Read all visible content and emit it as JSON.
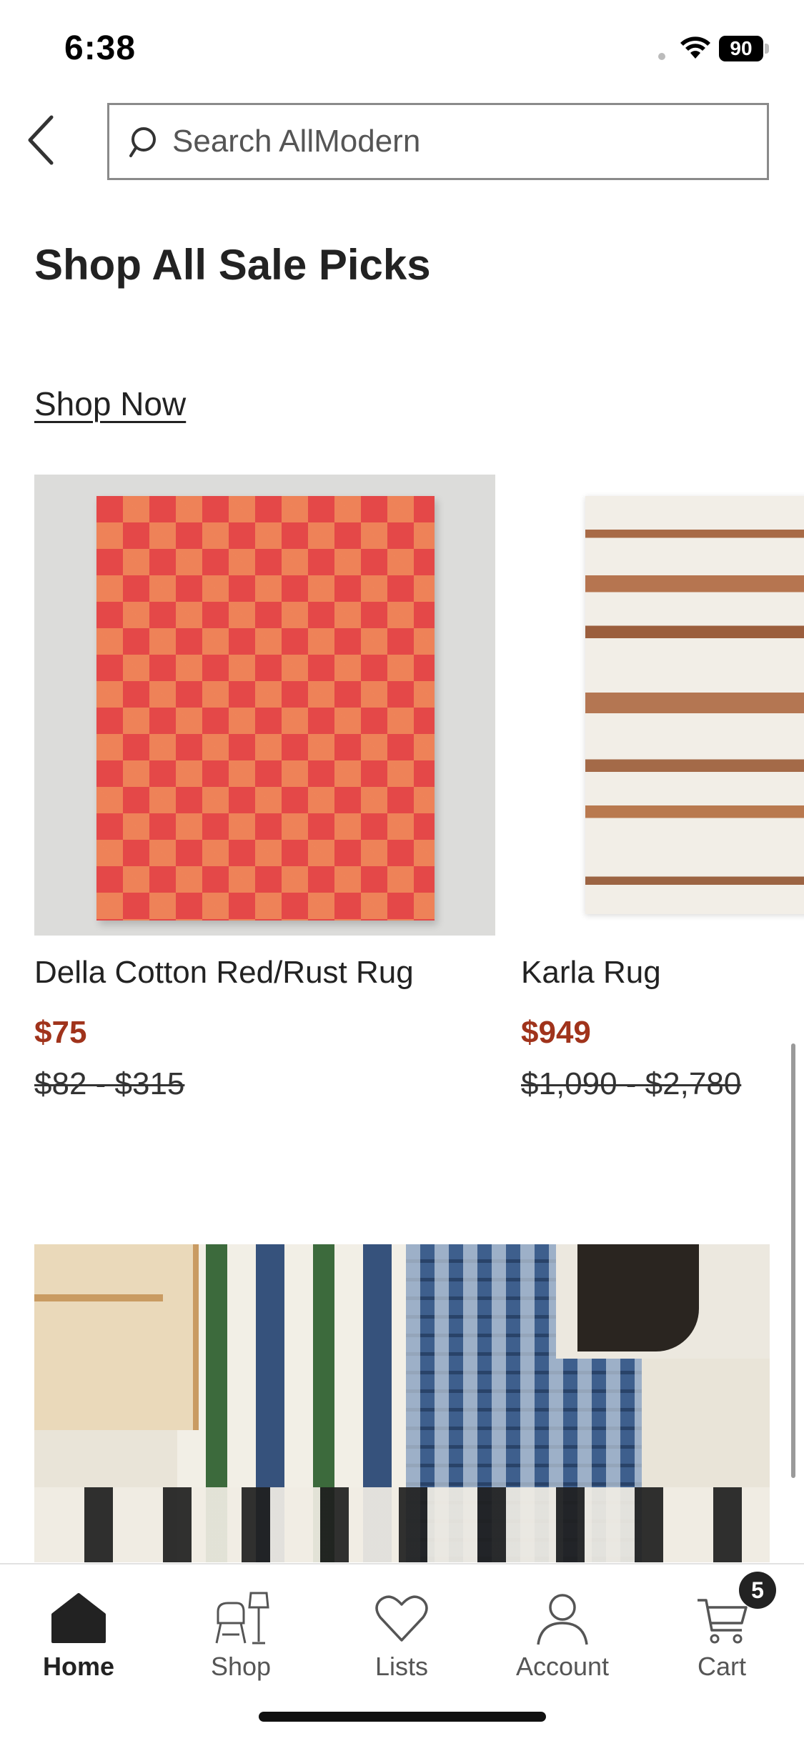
{
  "status_bar": {
    "time": "6:38",
    "battery": "90"
  },
  "search": {
    "placeholder": "Search AllModern"
  },
  "section": {
    "title": "Shop All Sale Picks",
    "cta": "Shop Now"
  },
  "products": [
    {
      "name": "Della Cotton Red/Rust Rug",
      "price": "$75",
      "original_price": "$82 - $315"
    },
    {
      "name": "Karla Rug",
      "price": "$949",
      "original_price": "$1,090 - $2,780"
    }
  ],
  "tab_bar": {
    "items": [
      {
        "label": "Home",
        "icon": "home-icon",
        "active": true
      },
      {
        "label": "Shop",
        "icon": "chair-lamp-icon",
        "active": false
      },
      {
        "label": "Lists",
        "icon": "heart-icon",
        "active": false
      },
      {
        "label": "Account",
        "icon": "person-icon",
        "active": false
      },
      {
        "label": "Cart",
        "icon": "cart-icon",
        "active": false
      }
    ],
    "cart_count": "5"
  },
  "colors": {
    "sale_price": "#a0331b",
    "text": "#222222"
  }
}
